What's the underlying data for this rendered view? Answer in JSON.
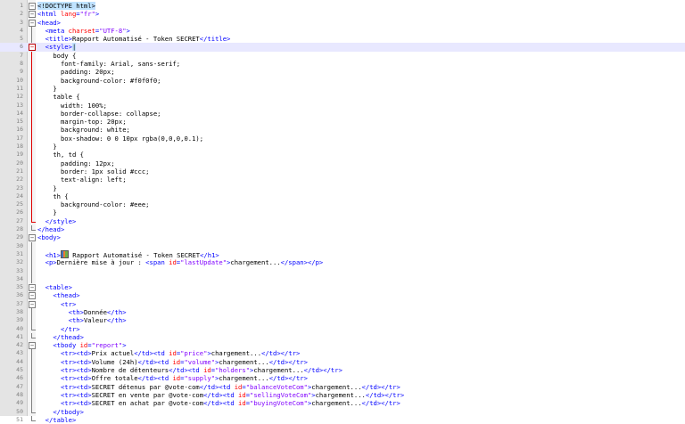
{
  "code_lines": [
    {
      "n": "1",
      "fold": "box",
      "html": "<span class=\"hl\">&lt;</span><span class=\"doctype\">!DOCTYPE html</span><span class=\"hl\">&gt;</span>"
    },
    {
      "n": "2",
      "fold": "box",
      "html": "<span class=\"tag\">&lt;html </span><span class=\"attr\">lang</span><span class=\"tag\">=</span><span class=\"val\">\"fr\"</span><span class=\"tag\">&gt;</span>"
    },
    {
      "n": "3",
      "fold": "box",
      "html": "<span class=\"tag\">&lt;head&gt;</span>"
    },
    {
      "n": "4",
      "fold": "bar",
      "html": "  <span class=\"tag\">&lt;meta </span><span class=\"attr\">charset</span><span class=\"tag\">=</span><span class=\"val\">\"UTF-8\"</span><span class=\"tag\">&gt;</span>"
    },
    {
      "n": "5",
      "fold": "bar",
      "html": "  <span class=\"tag\">&lt;title&gt;</span><span class=\"txt\">Rapport Automatisé - Token SECRET</span><span class=\"tag\">&lt;/title&gt;</span>"
    },
    {
      "n": "6",
      "fold": "boxred",
      "current": true,
      "html": "  <span class=\"tag\">&lt;style&gt;</span><span class=\"hl\">|</span>"
    },
    {
      "n": "7",
      "fold": "barred",
      "html": "    <span class=\"css\">body {</span>"
    },
    {
      "n": "8",
      "fold": "barred",
      "html": "      <span class=\"css\">font-family: Arial, sans-serif;</span>"
    },
    {
      "n": "9",
      "fold": "barred",
      "html": "      <span class=\"css\">padding: 20px;</span>"
    },
    {
      "n": "10",
      "fold": "barred",
      "html": "      <span class=\"css\">background-color: #f0f0f0;</span>"
    },
    {
      "n": "11",
      "fold": "barred",
      "html": "    <span class=\"css\">}</span>"
    },
    {
      "n": "12",
      "fold": "barred",
      "html": "    <span class=\"css\">table {</span>"
    },
    {
      "n": "13",
      "fold": "barred",
      "html": "      <span class=\"css\">width: 100%;</span>"
    },
    {
      "n": "14",
      "fold": "barred",
      "html": "      <span class=\"css\">border-collapse: collapse;</span>"
    },
    {
      "n": "15",
      "fold": "barred",
      "html": "      <span class=\"css\">margin-top: 20px;</span>"
    },
    {
      "n": "16",
      "fold": "barred",
      "html": "      <span class=\"css\">background: white;</span>"
    },
    {
      "n": "17",
      "fold": "barred",
      "html": "      <span class=\"css\">box-shadow: 0 0 10px rgba(0,0,0,0.1);</span>"
    },
    {
      "n": "18",
      "fold": "barred",
      "html": "    <span class=\"css\">}</span>"
    },
    {
      "n": "19",
      "fold": "barred",
      "html": "    <span class=\"css\">th, td {</span>"
    },
    {
      "n": "20",
      "fold": "barred",
      "html": "      <span class=\"css\">padding: 12px;</span>"
    },
    {
      "n": "21",
      "fold": "barred",
      "html": "      <span class=\"css\">border: 1px solid #ccc;</span>"
    },
    {
      "n": "22",
      "fold": "barred",
      "html": "      <span class=\"css\">text-align: left;</span>"
    },
    {
      "n": "23",
      "fold": "barred",
      "html": "    <span class=\"css\">}</span>"
    },
    {
      "n": "24",
      "fold": "barred",
      "html": "    <span class=\"css\">th {</span>"
    },
    {
      "n": "25",
      "fold": "barred",
      "html": "      <span class=\"css\">background-color: #eee;</span>"
    },
    {
      "n": "26",
      "fold": "barred",
      "html": "    <span class=\"css\">}</span>"
    },
    {
      "n": "27",
      "fold": "endred",
      "html": "  <span class=\"tag\">&lt;/style&gt;</span>"
    },
    {
      "n": "28",
      "fold": "end",
      "html": "<span class=\"tag\">&lt;/head&gt;</span>"
    },
    {
      "n": "29",
      "fold": "box",
      "html": "<span class=\"tag\">&lt;body&gt;</span>"
    },
    {
      "n": "30",
      "fold": "bar",
      "html": ""
    },
    {
      "n": "31",
      "fold": "bar",
      "html": "  <span class=\"tag\">&lt;h1&gt;</span><span class=\"txt\"><span class=\"icon-img\" data-name=\"chart-emoji-icon\" data-interactable=\"false\"></span> Rapport Automatisé - Token SECRET</span><span class=\"tag\">&lt;/h1&gt;</span>"
    },
    {
      "n": "32",
      "fold": "bar",
      "html": "  <span class=\"tag\">&lt;p&gt;</span><span class=\"txt\">Dernière mise à jour : </span><span class=\"tag\">&lt;span </span><span class=\"attr\">id</span><span class=\"tag\">=</span><span class=\"val\">\"lastUpdate\"</span><span class=\"tag\">&gt;</span><span class=\"txt\">chargement...</span><span class=\"tag\">&lt;/span&gt;&lt;/p&gt;</span>"
    },
    {
      "n": "33",
      "fold": "bar",
      "html": ""
    },
    {
      "n": "34",
      "fold": "bar",
      "html": ""
    },
    {
      "n": "35",
      "fold": "box",
      "html": "  <span class=\"tag\">&lt;table&gt;</span>"
    },
    {
      "n": "36",
      "fold": "box",
      "html": "    <span class=\"tag\">&lt;thead&gt;</span>"
    },
    {
      "n": "37",
      "fold": "box",
      "html": "      <span class=\"tag\">&lt;tr&gt;</span>"
    },
    {
      "n": "38",
      "fold": "bar",
      "html": "        <span class=\"tag\">&lt;th&gt;</span><span class=\"txt\">Donnée</span><span class=\"tag\">&lt;/th&gt;</span>"
    },
    {
      "n": "39",
      "fold": "bar",
      "html": "        <span class=\"tag\">&lt;th&gt;</span><span class=\"txt\">Valeur</span><span class=\"tag\">&lt;/th&gt;</span>"
    },
    {
      "n": "40",
      "fold": "end",
      "html": "      <span class=\"tag\">&lt;/tr&gt;</span>"
    },
    {
      "n": "41",
      "fold": "end",
      "html": "    <span class=\"tag\">&lt;/thead&gt;</span>"
    },
    {
      "n": "42",
      "fold": "box",
      "html": "    <span class=\"tag\">&lt;tbody </span><span class=\"attr\">id</span><span class=\"tag\">=</span><span class=\"val\">\"report\"</span><span class=\"tag\">&gt;</span>"
    },
    {
      "n": "43",
      "fold": "bar",
      "html": "      <span class=\"tag\">&lt;tr&gt;&lt;td&gt;</span><span class=\"txt\">Prix actuel</span><span class=\"tag\">&lt;/td&gt;&lt;td </span><span class=\"attr\">id</span><span class=\"tag\">=</span><span class=\"val\">\"price\"</span><span class=\"tag\">&gt;</span><span class=\"txt\">chargement...</span><span class=\"tag\">&lt;/td&gt;&lt;/tr&gt;</span>"
    },
    {
      "n": "44",
      "fold": "bar",
      "html": "      <span class=\"tag\">&lt;tr&gt;&lt;td&gt;</span><span class=\"txt\">Volume (24h)</span><span class=\"tag\">&lt;/td&gt;&lt;td </span><span class=\"attr\">id</span><span class=\"tag\">=</span><span class=\"val\">\"volume\"</span><span class=\"tag\">&gt;</span><span class=\"txt\">chargement...</span><span class=\"tag\">&lt;/td&gt;&lt;/tr&gt;</span>"
    },
    {
      "n": "45",
      "fold": "bar",
      "html": "      <span class=\"tag\">&lt;tr&gt;&lt;td&gt;</span><span class=\"txt\">Nombre de détenteurs</span><span class=\"tag\">&lt;/td&gt;&lt;td </span><span class=\"attr\">id</span><span class=\"tag\">=</span><span class=\"val\">\"holders\"</span><span class=\"tag\">&gt;</span><span class=\"txt\">chargement...</span><span class=\"tag\">&lt;/td&gt;&lt;/tr&gt;</span>"
    },
    {
      "n": "46",
      "fold": "bar",
      "html": "      <span class=\"tag\">&lt;tr&gt;&lt;td&gt;</span><span class=\"txt\">Offre totale</span><span class=\"tag\">&lt;/td&gt;&lt;td </span><span class=\"attr\">id</span><span class=\"tag\">=</span><span class=\"val\">\"supply\"</span><span class=\"tag\">&gt;</span><span class=\"txt\">chargement...</span><span class=\"tag\">&lt;/td&gt;&lt;/tr&gt;</span>"
    },
    {
      "n": "47",
      "fold": "bar",
      "html": "      <span class=\"tag\">&lt;tr&gt;&lt;td&gt;</span><span class=\"txt\">SECRET détenus par @vote-com</span><span class=\"tag\">&lt;/td&gt;&lt;td </span><span class=\"attr\">id</span><span class=\"tag\">=</span><span class=\"val\">\"balanceVoteCom\"</span><span class=\"tag\">&gt;</span><span class=\"txt\">chargement...</span><span class=\"tag\">&lt;/td&gt;&lt;/tr&gt;</span>"
    },
    {
      "n": "48",
      "fold": "bar",
      "html": "      <span class=\"tag\">&lt;tr&gt;&lt;td&gt;</span><span class=\"txt\">SECRET en vente par @vote-com</span><span class=\"tag\">&lt;/td&gt;&lt;td </span><span class=\"attr\">id</span><span class=\"tag\">=</span><span class=\"val\">\"sellingVoteCom\"</span><span class=\"tag\">&gt;</span><span class=\"txt\">chargement...</span><span class=\"tag\">&lt;/td&gt;&lt;/tr&gt;</span>"
    },
    {
      "n": "49",
      "fold": "bar",
      "html": "      <span class=\"tag\">&lt;tr&gt;&lt;td&gt;</span><span class=\"txt\">SECRET en achat par @vote-com</span><span class=\"tag\">&lt;/td&gt;&lt;td </span><span class=\"attr\">id</span><span class=\"tag\">=</span><span class=\"val\">\"buyingVoteCom\"</span><span class=\"tag\">&gt;</span><span class=\"txt\">chargement...</span><span class=\"tag\">&lt;/td&gt;&lt;/tr&gt;</span>"
    },
    {
      "n": "50",
      "fold": "end",
      "html": "    <span class=\"tag\">&lt;/tbody&gt;</span>"
    },
    {
      "n": "51",
      "fold": "end",
      "html": "  <span class=\"tag\">&lt;/table&gt;</span>"
    }
  ]
}
